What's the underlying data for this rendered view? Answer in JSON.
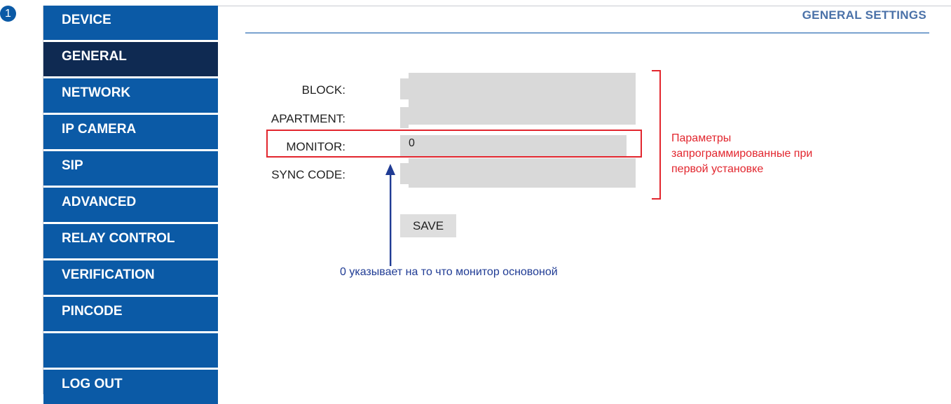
{
  "step_badge": "1",
  "sidebar": {
    "items": [
      {
        "label": "DEVICE"
      },
      {
        "label": "GENERAL"
      },
      {
        "label": "NETWORK"
      },
      {
        "label": "IP CAMERA"
      },
      {
        "label": "SIP"
      },
      {
        "label": "ADVANCED"
      },
      {
        "label": "RELAY CONTROL"
      },
      {
        "label": "VERIFICATION"
      },
      {
        "label": "PINCODE"
      },
      {
        "label": ""
      },
      {
        "label": "LOG OUT"
      }
    ],
    "active": "GENERAL"
  },
  "header": {
    "title": "GENERAL SETTINGS"
  },
  "form": {
    "block_label": "BLOCK:",
    "apartment_label": "APARTMENT:",
    "monitor_label": "MONITOR:",
    "monitor_value": "0",
    "sync_code_label": "SYNC CODE:",
    "save_label": "SAVE"
  },
  "annotations": {
    "red_note": [
      "Параметры",
      "запрограммированные при",
      "первой установке"
    ],
    "blue_note": "0 указывает на то что монитор основоной"
  },
  "colors": {
    "nav_blue": "#0b5aa6",
    "nav_active": "#0f2a52",
    "annotation_red": "#e2262e",
    "annotation_blue": "#1f3b94"
  }
}
